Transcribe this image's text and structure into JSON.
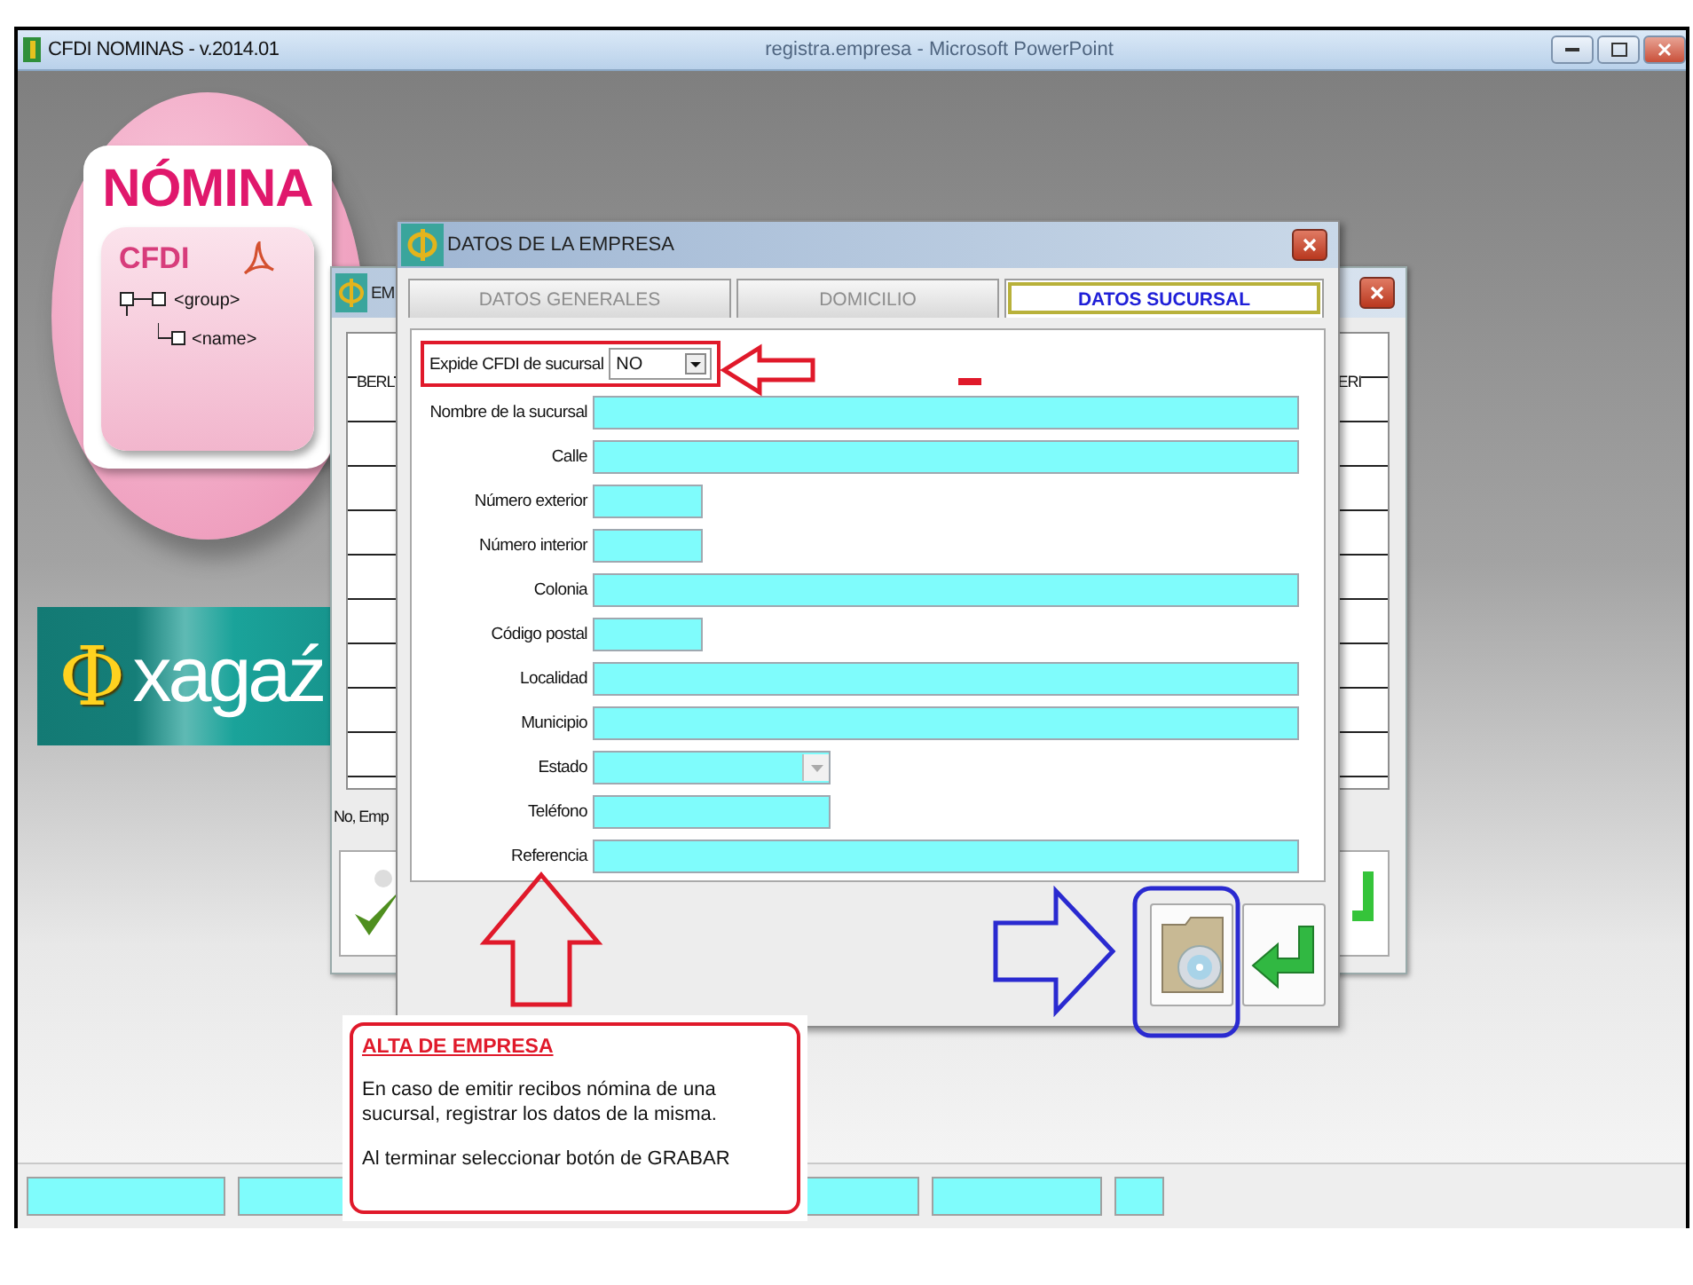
{
  "window": {
    "title": "CFDI NOMINAS - v.2014.01",
    "caption": "registra.empresa - Microsoft PowerPoint"
  },
  "logo": {
    "title": "NÓMINA",
    "subtitle": "CFDI",
    "tree": [
      {
        "label": "<group>"
      },
      {
        "label": "<name>"
      }
    ]
  },
  "brand": {
    "symbol": "Φ",
    "name": "xagaź"
  },
  "back_window": {
    "title": "EM",
    "grid_cells": [
      "BERL",
      "ERI"
    ],
    "footer": "No, Emp"
  },
  "dialog": {
    "title": "DATOS DE LA EMPRESA",
    "tabs": [
      {
        "label": "DATOS GENERALES",
        "selected": false
      },
      {
        "label": "DOMICILIO",
        "selected": false
      },
      {
        "label": "DATOS SUCURSAL",
        "selected": true
      }
    ],
    "branch_select": {
      "label": "Expide CFDI de sucursal",
      "value": "NO"
    },
    "fields": [
      {
        "label": "Nombre de la sucursal",
        "kind": "wide"
      },
      {
        "label": "Calle",
        "kind": "wide"
      },
      {
        "label": "Número exterior",
        "kind": "short"
      },
      {
        "label": "Número interior",
        "kind": "short"
      },
      {
        "label": "Colonia",
        "kind": "wide"
      },
      {
        "label": "Código postal",
        "kind": "short"
      },
      {
        "label": "Localidad",
        "kind": "wide"
      },
      {
        "label": "Municipio",
        "kind": "wide"
      },
      {
        "label": "Estado",
        "kind": "select"
      },
      {
        "label": "Teléfono",
        "kind": "medium"
      },
      {
        "label": "Referencia",
        "kind": "wide"
      }
    ]
  },
  "callout": {
    "title": "ALTA DE EMPRESA",
    "paragraphs": [
      "En caso de emitir recibos nómina de una sucursal, registrar los datos de la misma.",
      "Al terminar seleccionar botón de GRABAR"
    ]
  }
}
